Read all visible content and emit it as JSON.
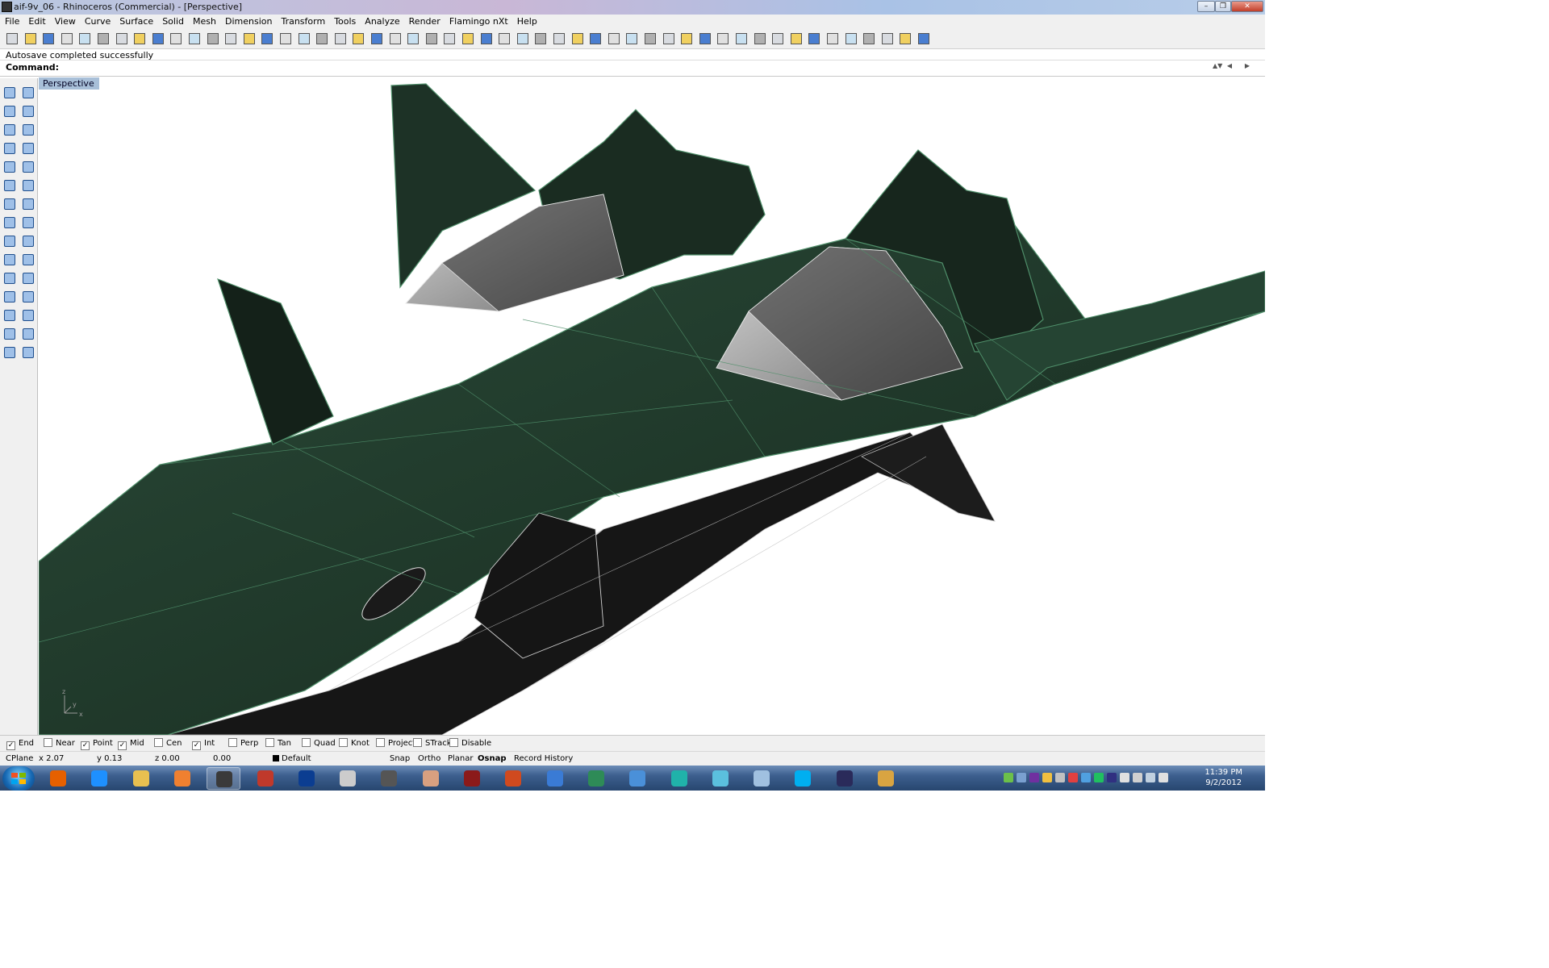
{
  "window": {
    "title": "aif-9v_06 - Rhinoceros (Commercial) - [Perspective]"
  },
  "menu": [
    "File",
    "Edit",
    "View",
    "Curve",
    "Surface",
    "Solid",
    "Mesh",
    "Dimension",
    "Transform",
    "Tools",
    "Analyze",
    "Render",
    "Flamingo nXt",
    "Help"
  ],
  "toolbar": {
    "icons": [
      "new-icon",
      "open-icon",
      "save-icon",
      "print-icon",
      "import-icon",
      "cut-icon",
      "copy-icon",
      "paste-icon",
      "undo-icon",
      "pan-icon",
      "rotate-view-icon",
      "zoom-icon",
      "zoom-window-icon",
      "zoom-extents-icon",
      "zoom-selected-icon",
      "rotate-icon",
      "four-views-icon",
      "car-icon",
      "car-hidden-icon",
      "named-cplane-icon",
      "points-icon",
      "light-icon",
      "lock-icon",
      "layer-icon",
      "color-wheel-icon",
      "wireframe-sphere-icon",
      "shaded-sphere-icon",
      "rendered-sphere-icon",
      "pointer-icon",
      "gear-icon",
      "dimension-icon",
      "help-icon",
      "box-icon",
      "cplane-icon",
      "grip-icon",
      "block-icon",
      "grid-icon",
      "snap-icon",
      "curve-tool-icon",
      "mesh-icon",
      "analysis-icon",
      "surface-tool-icon",
      "loft-icon",
      "patch-icon",
      "split-icon",
      "trim-icon",
      "extend-icon",
      "network-icon",
      "sweep-icon",
      "blend-icon",
      "render-window-icon"
    ]
  },
  "command": {
    "history": "Autosave completed successfully",
    "label": "Command:",
    "value": ""
  },
  "viewport": {
    "name": "Perspective",
    "axis_labels": {
      "z": "z",
      "y": "y",
      "x": "x"
    },
    "model_colors": {
      "hull": "#1f3a2c",
      "edges": "#4f8f6a",
      "dark": "#1a1a1a",
      "glass": "#bcbcbc"
    }
  },
  "left_tools": [
    "select-icon",
    "point-icon",
    "polyline-icon",
    "curve-icon",
    "circle-icon",
    "ellipse-icon",
    "arc-icon",
    "rectangle-icon",
    "polygon-icon",
    "fillet-icon",
    "surface-icon",
    "revolve-icon",
    "box-solid-icon",
    "boolean-icon",
    "cylinder-icon",
    "extrude-icon",
    "explode-icon",
    "explode-solid-icon",
    "trim-tool-icon",
    "split-tool-icon",
    "join-icon",
    "fillet-edge-icon",
    "curve-from-object-icon",
    "offset-icon",
    "text-icon",
    "scale-icon",
    "array-icon",
    "transform-icon",
    "solid-tools-icon",
    "dimension-tool-icon"
  ],
  "osnaps": [
    {
      "label": "End",
      "checked": true
    },
    {
      "label": "Near",
      "checked": false
    },
    {
      "label": "Point",
      "checked": true
    },
    {
      "label": "Mid",
      "checked": true
    },
    {
      "label": "Cen",
      "checked": false
    },
    {
      "label": "Int",
      "checked": true
    },
    {
      "label": "Perp",
      "checked": false
    },
    {
      "label": "Tan",
      "checked": false
    },
    {
      "label": "Quad",
      "checked": false
    },
    {
      "label": "Knot",
      "checked": false
    },
    {
      "label": "Project",
      "checked": false
    },
    {
      "label": "STrack",
      "checked": false
    },
    {
      "label": "Disable",
      "checked": false
    }
  ],
  "status": {
    "cplane": "CPlane",
    "x": "x 2.07",
    "y": "y 0.13",
    "z": "z 0.00",
    "dist": "0.00",
    "layer": "Default",
    "snap": "Snap",
    "ortho": "Ortho",
    "planar": "Planar",
    "osnap": "Osnap",
    "record_history": "Record History"
  },
  "taskbar": {
    "apps": [
      "firefox-icon",
      "internet-explorer-icon",
      "folder-icon",
      "media-player-icon",
      "rhino-icon",
      "sketchup-icon",
      "photoshop-icon",
      "zbrush-icon",
      "blender-icon",
      "hand-icon",
      "security-icon",
      "powerpoint-icon",
      "file-transfer-icon",
      "map-icon",
      "group-icon",
      "app-icon",
      "chart-icon",
      "calculator-icon",
      "skype-icon",
      "video-icon",
      "archive-icon"
    ],
    "time": "11:39 PM",
    "date": "9/2/2012"
  }
}
